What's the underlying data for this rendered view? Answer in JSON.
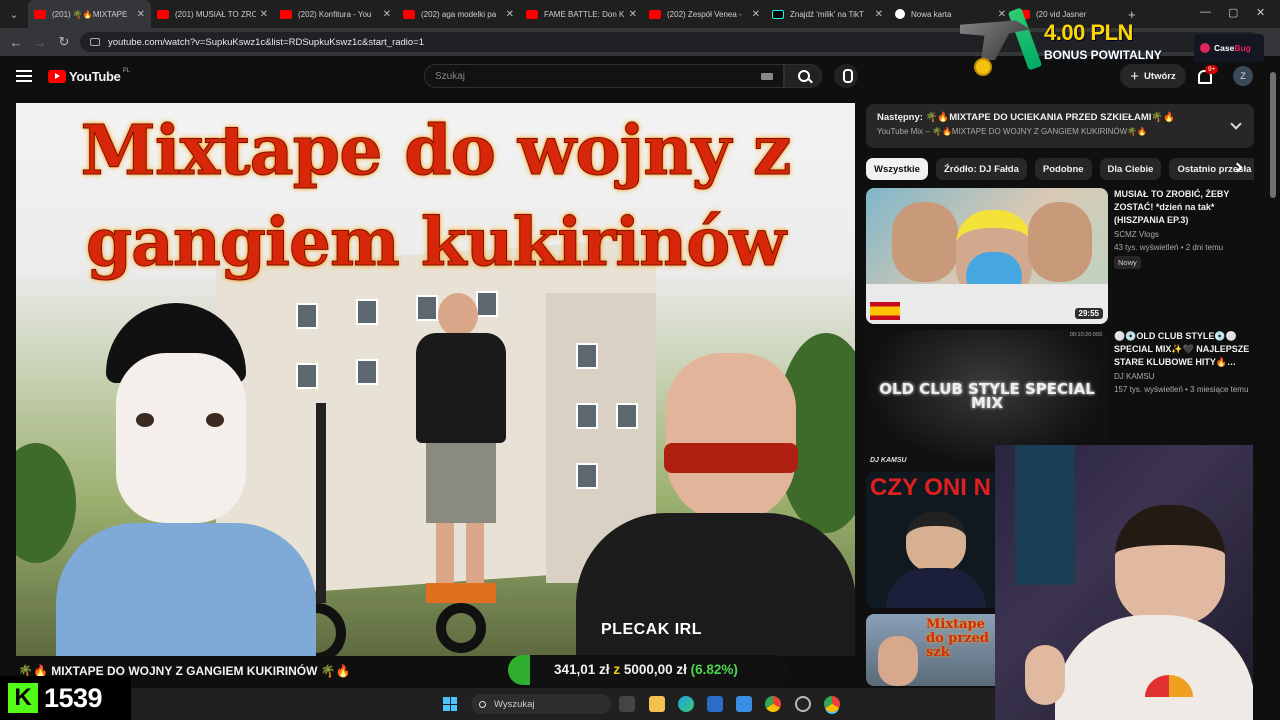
{
  "browser": {
    "tabs": [
      {
        "title": "(201) 🌴🔥MIXTAPE",
        "active": true,
        "icon": "youtube-icon"
      },
      {
        "title": "(201) MUSIAŁ TO ZRO",
        "active": false,
        "icon": "youtube-icon"
      },
      {
        "title": "(202) Konfitura - You",
        "active": false,
        "icon": "youtube-icon"
      },
      {
        "title": "(202) aga modelki pa",
        "active": false,
        "icon": "youtube-icon"
      },
      {
        "title": "FAME BATTLE: Don K",
        "active": false,
        "icon": "youtube-icon"
      },
      {
        "title": "(202) Zespół Venea -",
        "active": false,
        "icon": "youtube-icon"
      },
      {
        "title": "Znajdź 'milik' na TikT",
        "active": false,
        "icon": "tiktok-icon"
      },
      {
        "title": "Nowa karta",
        "active": false,
        "icon": "google-icon"
      },
      {
        "title": "(20 vid Jasner",
        "active": false,
        "icon": "youtube-icon"
      }
    ],
    "url": "youtube.com/watch?v=SupkuKswz1c&list=RDSupkuKswz1c&start_radio=1"
  },
  "promo": {
    "amount": "4.00 PLN",
    "subtitle": "BONUS POWITALNY",
    "brand_a": "Case",
    "brand_b": "Bug"
  },
  "header": {
    "logo_text": "YouTube",
    "region": "PL",
    "search_placeholder": "Szukaj",
    "create_label": "Utwórz",
    "notif_count": "9+",
    "avatar_letter": "Z"
  },
  "video": {
    "title_line1": "Mixtape do wojny z",
    "title_line2": "gangiem kukirinów",
    "overlay_label": "PLECAK IRL",
    "heading": "🌴🔥 MIXTAPE DO WOJNY Z GANGIEM KUKIRINÓW 🌴🔥"
  },
  "donation": {
    "current": "341,01 zł",
    "sep": "z",
    "goal": "5000,00 zł",
    "percent_label": "(6.82%)",
    "progress": 0.0682
  },
  "counter": {
    "logo": "K",
    "value": "1539"
  },
  "taskbar": {
    "search_placeholder": "Wyszukaj"
  },
  "sidebar": {
    "next_title": "Następny: 🌴🔥MIXTAPE DO UCIEKANIA PRZED SZKIEŁAMI🌴🔥",
    "next_sub": "YouTube Mix – 🌴🔥MIXTAPE DO WOJNY Z GANGIEM KUKIRINÓW🌴🔥",
    "chips": [
      "Wszystkie",
      "Źródło: DJ Fałda",
      "Podobne",
      "Dla Ciebie",
      "Ostatnio przesła"
    ],
    "recs": [
      {
        "title": "MUSIAŁ TO ZROBIĆ, ŻEBY ZOSTAĆ! *dzień na tak* (HISZPANIA EP.3)",
        "channel": "SCMZ Vlogs",
        "meta": "43 tys. wyświetleń • 2 dni temu",
        "badge": "Nowy",
        "duration": "29:55",
        "thumb_text": ""
      },
      {
        "title": "⚪💿OLD CLUB STYLE💿⚪ SPECIAL MIX✨🖤 NAJLEPSZE STARE KLUBOWE HITY🔥…",
        "channel": "DJ KAMSU",
        "meta": "157 tys. wyświetleń • 3 miesiące temu",
        "badge": "",
        "duration": "",
        "thumb_text": "OLD CLUB STYLE SPECIAL MIX",
        "thumb_small": "DJ KAMSU",
        "thumb_time": "00:10:26:093"
      },
      {
        "title": "",
        "channel": "",
        "meta": "",
        "badge": "",
        "duration": "",
        "thumb_text": "CZY ONI N"
      },
      {
        "title": "",
        "channel": "",
        "meta": "",
        "badge": "",
        "duration": "",
        "thumb_text": "Mixtape do przed szk"
      }
    ]
  }
}
